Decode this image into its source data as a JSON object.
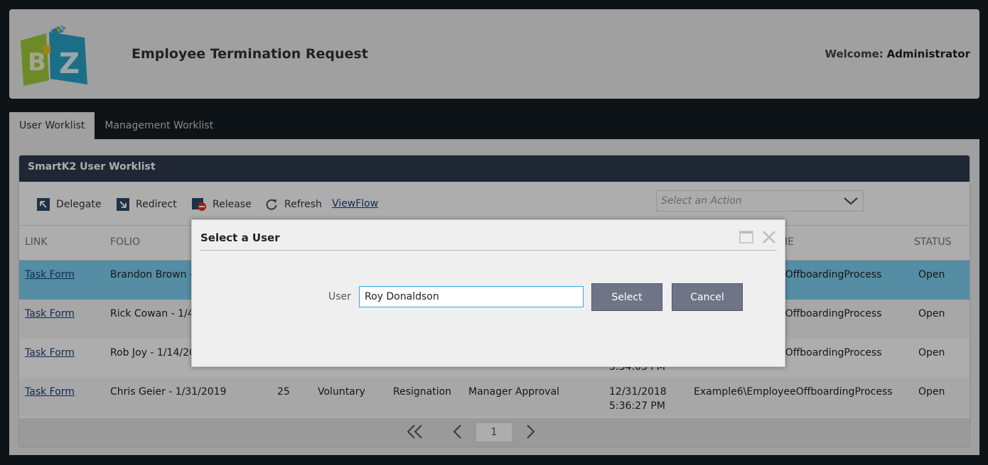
{
  "header": {
    "title": "Employee Termination Request",
    "welcome_label": "Welcome:",
    "welcome_user": "Administrator",
    "logo_letters": [
      "B",
      "Z"
    ]
  },
  "tabs": [
    {
      "label": "User Worklist",
      "active": true
    },
    {
      "label": "Management Worklist",
      "active": false
    }
  ],
  "panel": {
    "title": "SmartK2 User Worklist",
    "toolbar": {
      "delegate": "Delegate",
      "redirect": "Redirect",
      "release": "Release",
      "refresh": "Refresh",
      "viewflow": "ViewFlow",
      "action_placeholder": "Select an Action"
    },
    "columns": {
      "link": "LINK",
      "folio": "FOLIO",
      "name_suffix": "ME",
      "status": "STATUS"
    },
    "rows": [
      {
        "link": "Task Form",
        "folio": "Brandon Brown -",
        "process": "eOffboardingProcess",
        "status": "Open"
      },
      {
        "link": "Task Form",
        "folio": "Rick Cowan - 1/4,",
        "process": "eOffboardingProcess",
        "status": "Open"
      },
      {
        "link": "Task Form",
        "folio": "Rob Joy - 1/14/20",
        "process": "eOffboardingProcess",
        "status": "Open",
        "date_fragment": "5:34:05 PM"
      },
      {
        "link": "Task Form",
        "folio": "Chris Geier - 1/31/2019",
        "id": "25",
        "type": "Voluntary",
        "reason": "Resignation",
        "activity": "Manager Approval",
        "date": "12/31/2018",
        "time": "5:36:27 PM",
        "process": "Example6\\EmployeeOffboardingProcess",
        "status": "Open"
      }
    ],
    "pager": {
      "page": "1"
    }
  },
  "dialog": {
    "title": "Select a User",
    "user_label": "User",
    "user_value": "Roy Donaldson",
    "select_label": "Select",
    "cancel_label": "Cancel"
  },
  "colors": {
    "panel_header": "#2e3a4d",
    "selected_row": "#7dd0f2",
    "button": "#6e7586",
    "input_focus": "#3aa6d8"
  }
}
